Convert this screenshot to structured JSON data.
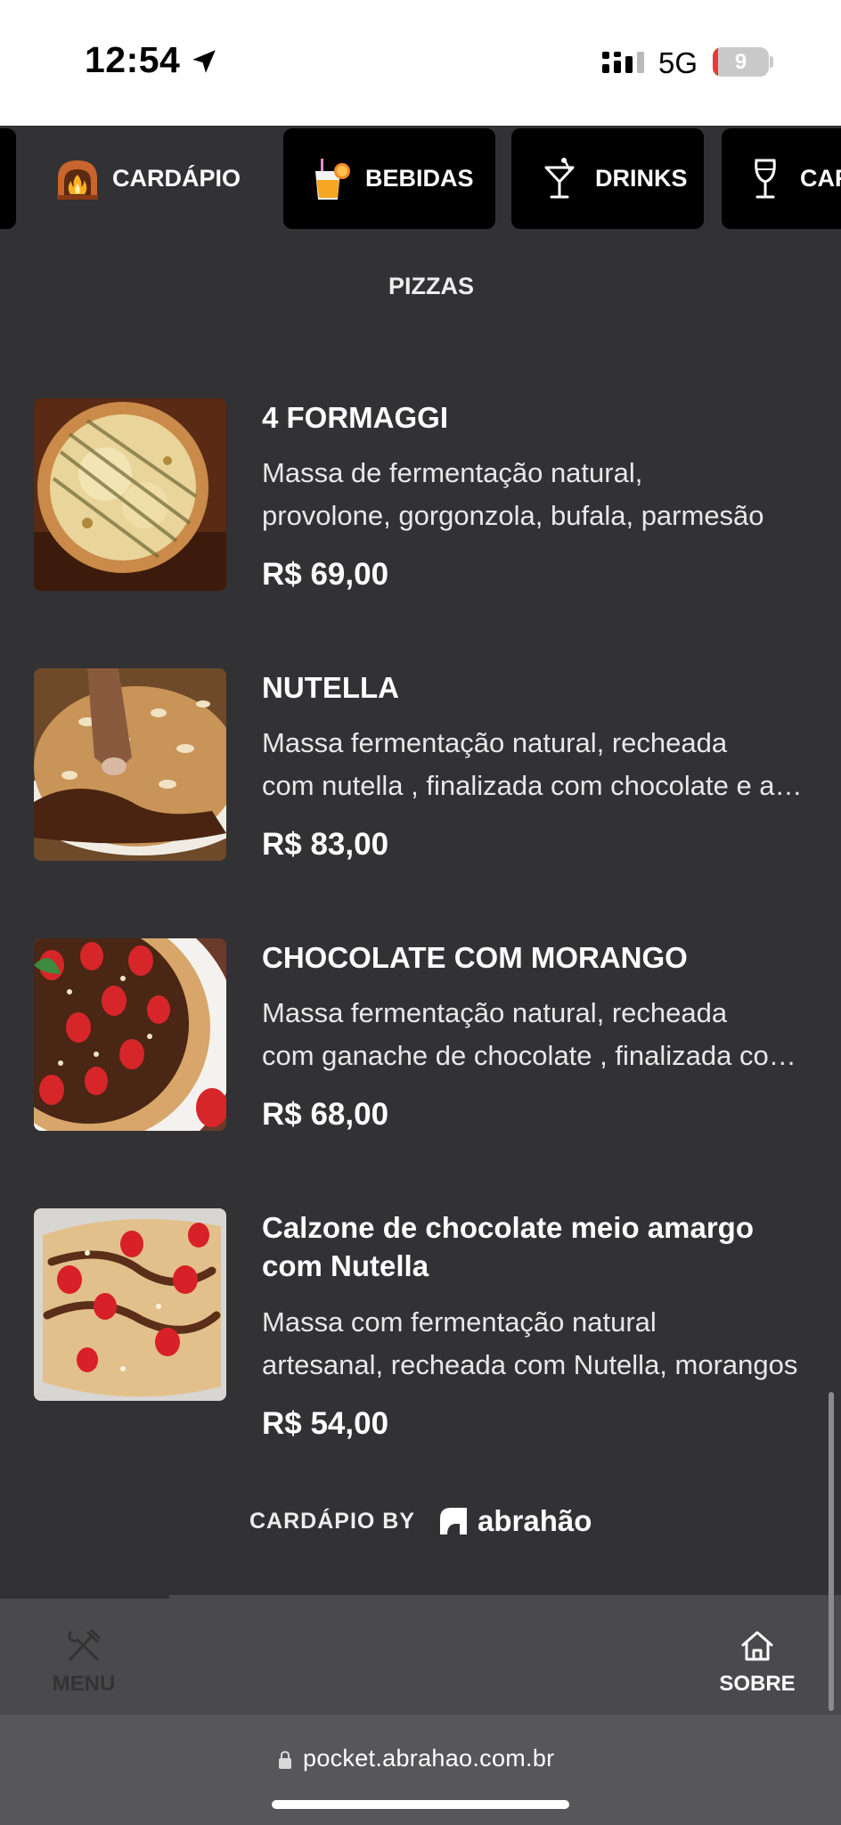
{
  "status_bar": {
    "time": "12:54",
    "network": "5G",
    "battery": "9",
    "battery_level": 0.09
  },
  "tabs": [
    {
      "label": "CARDÁPIO",
      "icon": "oven-icon",
      "active": true
    },
    {
      "label": "BEBIDAS",
      "icon": "juice-icon",
      "active": false
    },
    {
      "label": "DRINKS",
      "icon": "cocktail-icon",
      "active": false
    },
    {
      "label": "CAR",
      "icon": "wine-glass-icon",
      "active": false
    }
  ],
  "section": {
    "title": "PIZZAS"
  },
  "items": [
    {
      "name": "4 FORMAGGI",
      "desc_line1": "Massa de fermentação natural,",
      "desc_line2": "provolone, gorgonzola, bufala, parmesão",
      "price": "R$ 69,00"
    },
    {
      "name": "NUTELLA",
      "desc_line1": "Massa fermentação natural, recheada",
      "desc_line2": "com nutella , finalizada com chocolate e amêndoas",
      "price": "R$ 83,00"
    },
    {
      "name": "CHOCOLATE COM MORANGO",
      "desc_line1": "Massa fermentação natural, recheada",
      "desc_line2": "com ganache de chocolate , finalizada com morangos",
      "price": "R$ 68,00"
    },
    {
      "name": "Calzone de chocolate meio amargo com Nutella",
      "desc_line1": "Massa com fermentação natural",
      "desc_line2": "artesanal, recheada com Nutella, morangos",
      "price": "R$ 54,00"
    }
  ],
  "footer": {
    "by_label": "CARDÁPIO BY",
    "brand": "abrahão"
  },
  "bottom_nav": {
    "menu_label": "MENU",
    "sobre_label": "SOBRE"
  },
  "browser": {
    "url": "pocket.abrahao.com.br"
  }
}
